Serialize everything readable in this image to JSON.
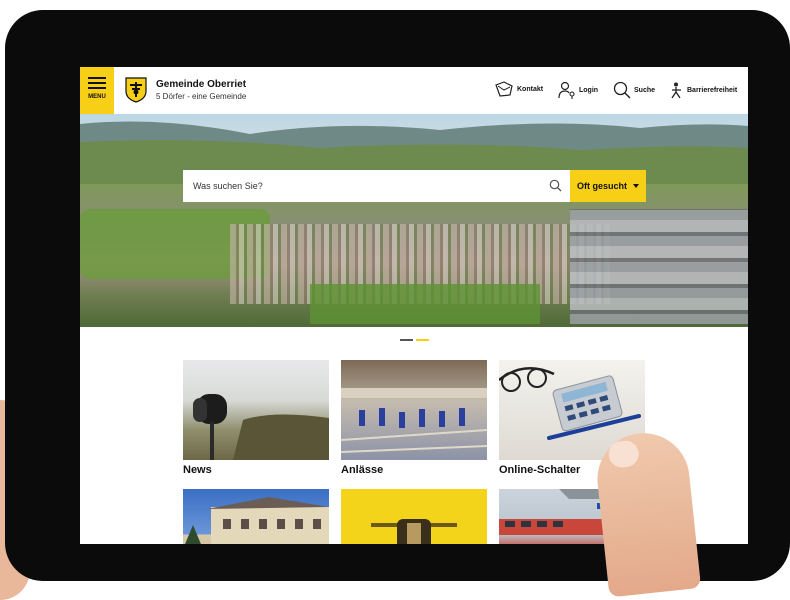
{
  "header": {
    "menu_label": "MENU",
    "brand_title": "Gemeinde Oberriet",
    "brand_subtitle": "5 Dörfer - eine Gemeinde",
    "nav": [
      {
        "label": "Kontakt",
        "icon": "contact-icon"
      },
      {
        "label": "Login",
        "icon": "user-key-icon"
      },
      {
        "label": "Suche",
        "icon": "search-icon"
      },
      {
        "label": "Barrierefreiheit",
        "icon": "accessibility-icon"
      }
    ]
  },
  "hero": {
    "search_placeholder": "Was suchen Sie?",
    "frequent_label": "Oft gesucht"
  },
  "tiles": [
    {
      "label": "News"
    },
    {
      "label": "Anlässe"
    },
    {
      "label": "Online-Schalter"
    }
  ],
  "colors": {
    "accent": "#f7cf16",
    "text": "#111111",
    "bezel": "#0b0b0b"
  }
}
